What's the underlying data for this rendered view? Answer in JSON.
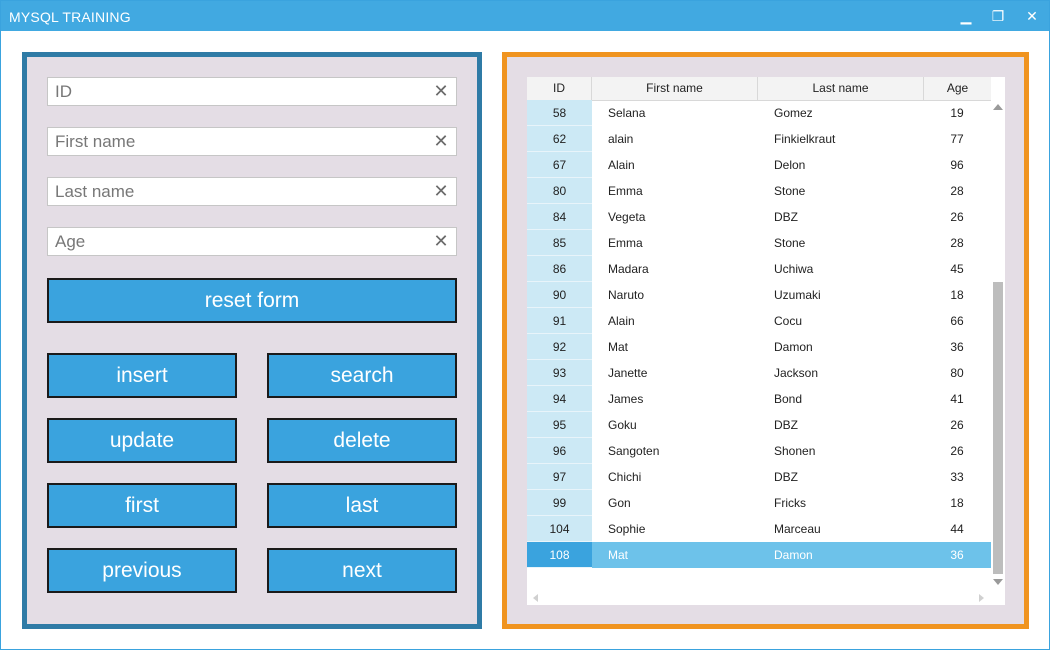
{
  "window": {
    "title": "MYSQL TRAINING",
    "minimize_icon": "minimize-icon",
    "maximize_icon": "maximize-icon",
    "close_icon": "close-icon",
    "min_glyph": "▁",
    "max_glyph": "❐",
    "close_glyph": "✕"
  },
  "colors": {
    "titlebar": "#41a9e1",
    "accent_button": "#3aa3de",
    "left_border": "#2f7ba6",
    "right_border": "#f0941f",
    "panel_bg": "#e4dde5",
    "selected_row": "#6dc2ea"
  },
  "form": {
    "id_placeholder": "ID",
    "first_name_placeholder": "First name",
    "last_name_placeholder": "Last name",
    "age_placeholder": "Age",
    "clear_glyph": "✕"
  },
  "buttons": {
    "reset": "reset form",
    "insert": "insert",
    "search": "search",
    "update": "update",
    "delete": "delete",
    "first": "first",
    "last": "last",
    "previous": "previous",
    "next": "next"
  },
  "table": {
    "columns": [
      "ID",
      "First name",
      "Last name",
      "Age"
    ],
    "selected_index": 17,
    "rows": [
      {
        "id": "58",
        "first": "Selana",
        "last": "Gomez",
        "age": "19"
      },
      {
        "id": "62",
        "first": "alain",
        "last": "Finkielkraut",
        "age": "77"
      },
      {
        "id": "67",
        "first": "Alain",
        "last": "Delon",
        "age": "96"
      },
      {
        "id": "80",
        "first": "Emma",
        "last": "Stone",
        "age": "28"
      },
      {
        "id": "84",
        "first": "Vegeta",
        "last": "DBZ",
        "age": "26"
      },
      {
        "id": "85",
        "first": "Emma",
        "last": "Stone",
        "age": "28"
      },
      {
        "id": "86",
        "first": "Madara",
        "last": "Uchiwa",
        "age": "45"
      },
      {
        "id": "90",
        "first": "Naruto",
        "last": "Uzumaki",
        "age": "18"
      },
      {
        "id": "91",
        "first": "Alain",
        "last": "Cocu",
        "age": "66"
      },
      {
        "id": "92",
        "first": "Mat",
        "last": "Damon",
        "age": "36"
      },
      {
        "id": "93",
        "first": "Janette",
        "last": "Jackson",
        "age": "80"
      },
      {
        "id": "94",
        "first": "James",
        "last": "Bond",
        "age": "41"
      },
      {
        "id": "95",
        "first": "Goku",
        "last": "DBZ",
        "age": "26"
      },
      {
        "id": "96",
        "first": "Sangoten",
        "last": "Shonen",
        "age": "26"
      },
      {
        "id": "97",
        "first": "Chichi",
        "last": "DBZ",
        "age": "33"
      },
      {
        "id": "99",
        "first": "Gon",
        "last": "Fricks",
        "age": "18"
      },
      {
        "id": "104",
        "first": "Sophie",
        "last": "Marceau",
        "age": "44"
      },
      {
        "id": "108",
        "first": "Mat",
        "last": "Damon",
        "age": "36"
      }
    ]
  }
}
